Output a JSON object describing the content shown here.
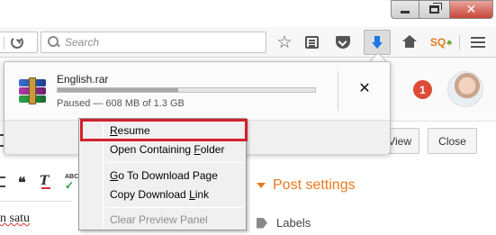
{
  "toolbar": {
    "search_placeholder": "Search",
    "addon_text": "SQ"
  },
  "page": {
    "notification_count": "1",
    "view_button": "View",
    "close_button": "Close",
    "body_text": "n satu",
    "post_settings": "Post settings",
    "labels": "Labels",
    "spell_abbrev": "ABC"
  },
  "download": {
    "filename": "English.rar",
    "status": "Paused — 608 MB of 1.3 GB",
    "progress_fraction": 0.47,
    "cancel_glyph": "✕"
  },
  "context_menu": {
    "items": [
      {
        "label": "Resume",
        "accel": "R",
        "enabled": true,
        "highlighted": true
      },
      {
        "label": "Open Containing Folder",
        "accel": "F",
        "enabled": true
      },
      {
        "label": "Go To Download Page",
        "accel": "G",
        "enabled": true
      },
      {
        "label": "Copy Download Link",
        "accel": "L",
        "enabled": true
      },
      {
        "label": "Clear Preview Panel",
        "accel": "",
        "enabled": false
      }
    ]
  },
  "colors": {
    "download_accent": "#1f77e6",
    "highlight_border": "#d3202d",
    "post_settings_orange": "#e8781f",
    "notification_red": "#dd4b39"
  },
  "icons": {
    "reload": "reload-icon",
    "search": "search-icon",
    "bookmark": "star-icon",
    "reading_list": "reading-list-icon",
    "pocket": "pocket-icon",
    "downloads": "download-arrow-icon",
    "home": "home-icon",
    "menu": "hamburger-menu-icon",
    "file": "winrar-archive-icon",
    "cancel": "close-icon"
  }
}
